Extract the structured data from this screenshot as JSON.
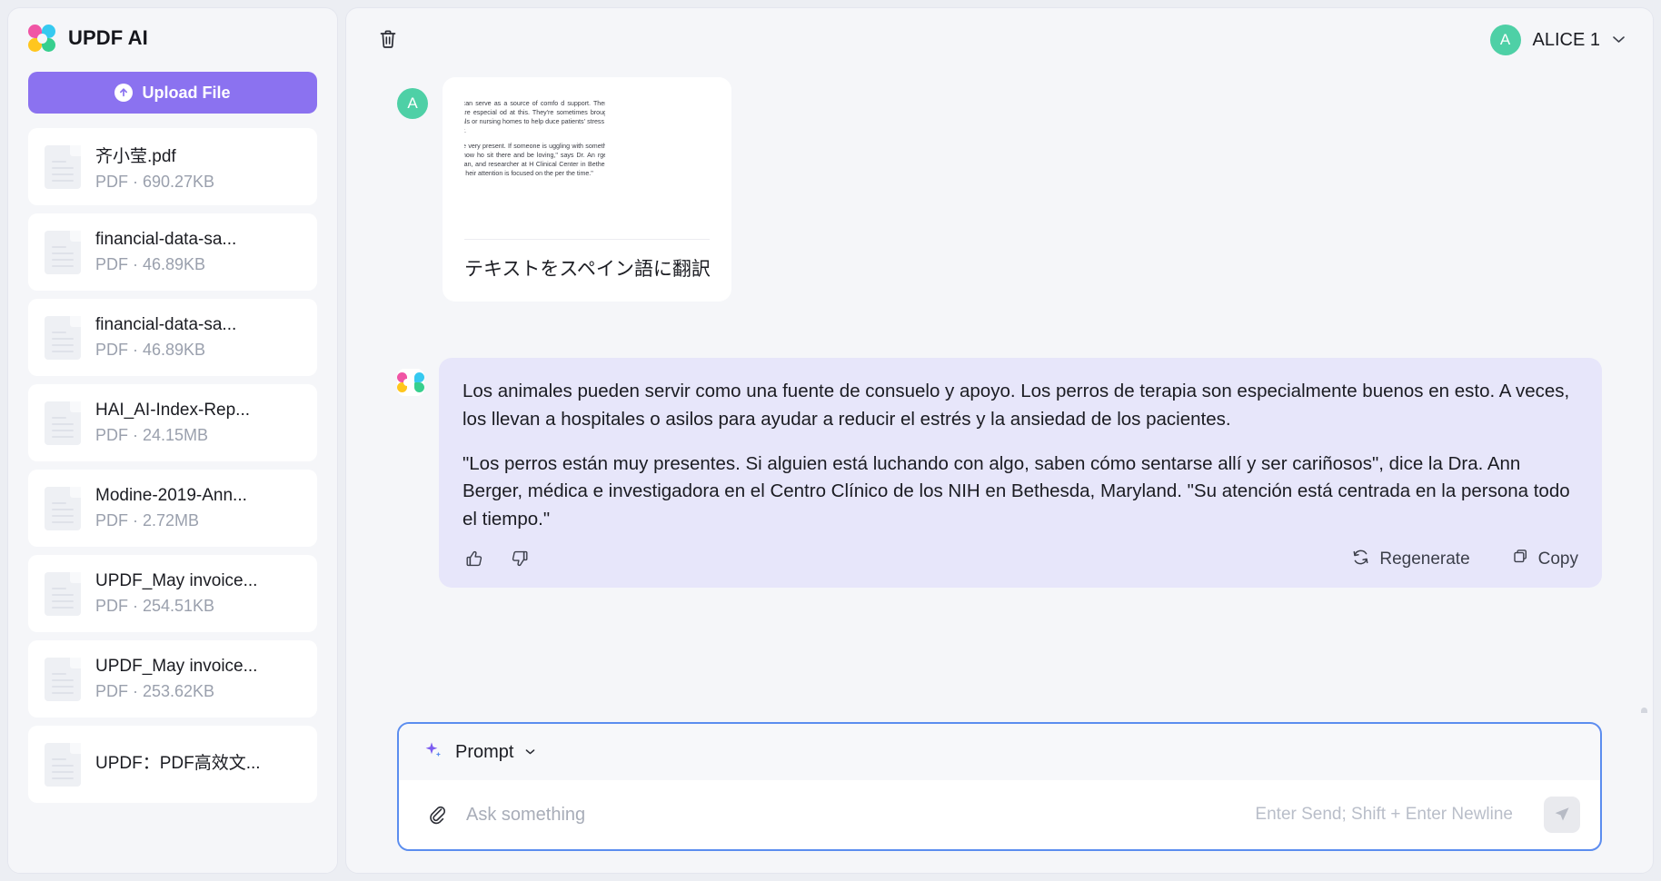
{
  "sidebar": {
    "app_title": "UPDF AI",
    "logo_icon": "updf-clover-logo",
    "upload_button": {
      "label": "Upload File",
      "icon": "upload-arrow-icon",
      "color": "#8b72f0"
    },
    "files": [
      {
        "name": "齐小莹.pdf",
        "meta": "PDF · 690.27KB"
      },
      {
        "name": "financial-data-sa...",
        "meta": "PDF · 46.89KB"
      },
      {
        "name": "financial-data-sa...",
        "meta": "PDF · 46.89KB"
      },
      {
        "name": "HAI_AI-Index-Rep...",
        "meta": "PDF · 24.15MB"
      },
      {
        "name": "Modine-2019-Ann...",
        "meta": "PDF · 2.72MB"
      },
      {
        "name": "UPDF_May invoice...",
        "meta": "PDF · 254.51KB"
      },
      {
        "name": "UPDF_May invoice...",
        "meta": "PDF · 253.62KB"
      },
      {
        "name": "UPDF：PDF高效文...",
        "meta": ""
      }
    ]
  },
  "header": {
    "delete_icon": "trash-icon",
    "user_name": "ALICE 1",
    "avatar_letter": "A",
    "avatar_color": "#4ed0a6",
    "caret_icon": "chevron-down-icon"
  },
  "conversation": {
    "user_message": {
      "avatar_letter": "A",
      "caption": "テキストをスペイン語に翻訳",
      "thumbnail_paragraphs": [
        "imals can serve as a source of comfo d support. Therapy dogs are especial od at this. They're sometimes brough o hospitals or nursing homes to help duce patients' stress and anxiety.",
        "ogs are very present. If someone is uggling with something, they know ho sit there and be loving,\" says Dr. An rger, a physician, and researcher at H Clinical Center in Bethesda, Maryla heir attention is focused on the per the time.\""
      ]
    },
    "assistant_message": {
      "bubble_color": "#e7e6fa",
      "paragraphs": [
        "Los animales pueden servir como una fuente de consuelo y apoyo. Los perros de terapia son especialmente buenos en esto. A veces, los llevan a hospitales o asilos para ayudar a reducir el estrés y la ansiedad de los pacientes.",
        "\"Los perros están muy presentes. Si alguien está luchando con algo, saben cómo sentarse allí y ser cariñosos\", dice la Dra. Ann Berger, médica e investigadora en el Centro Clínico de los NIH en Bethesda, Maryland. \"Su atención está centrada en la persona todo el tiempo.\""
      ],
      "actions": {
        "thumbs_up_icon": "thumbs-up-icon",
        "thumbs_down_icon": "thumbs-down-icon",
        "regenerate_label": "Regenerate",
        "regenerate_icon": "refresh-icon",
        "copy_label": "Copy",
        "copy_icon": "copy-icon"
      }
    }
  },
  "composer": {
    "prompt_label": "Prompt",
    "prompt_icon": "sparkle-icon",
    "dropdown_icon": "caret-down-icon",
    "attach_icon": "paperclip-icon",
    "input_value": "",
    "placeholder": "Ask something",
    "hint": "Enter Send; Shift + Enter Newline",
    "send_icon": "send-plane-icon",
    "border_color": "#5b8def"
  }
}
